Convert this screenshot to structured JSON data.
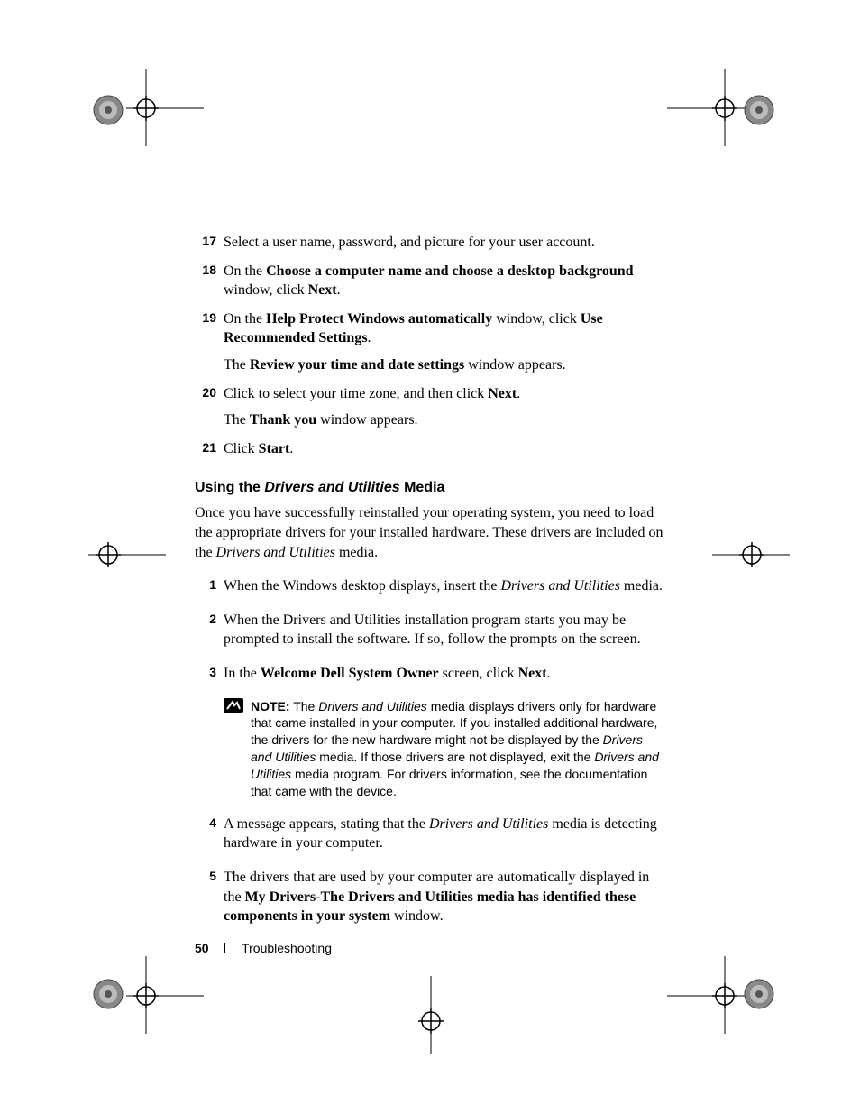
{
  "steps_a": [
    {
      "n": "17",
      "html": "Select a user name, password, and picture for your user account."
    },
    {
      "n": "18",
      "html": "On the <span class=\"b\">Choose a computer name and choose a desktop background</span> window, click <span class=\"b\">Next</span>."
    },
    {
      "n": "19",
      "html": "On the <span class=\"b\">Help Protect Windows automatically</span> window, click <span class=\"b\">Use Recommended Settings</span>.",
      "html2": "The <span class=\"b\">Review your time and date settings</span> window appears."
    },
    {
      "n": "20",
      "html": "Click to select your time zone, and then click <span class=\"b\">Next</span>.",
      "html2": "The <span class=\"b\">Thank you</span> window appears."
    },
    {
      "n": "21",
      "html": "Click <span class=\"b\">Start</span>."
    }
  ],
  "heading": {
    "pre": "Using the ",
    "em": "Drivers and Utilities",
    "post": " Media"
  },
  "intro": "Once you have successfully reinstalled your operating system, you need to load the appropriate drivers for your installed hardware. These drivers are included on the <span class=\"i\">Drivers and Utilities</span> media.",
  "steps_b": [
    {
      "n": "1",
      "html": "When the Windows desktop displays, insert the <span class=\"i\">Drivers and Utilities</span> media."
    },
    {
      "n": "2",
      "html": "When the Drivers and Utilities installation program starts you may be prompted to install the software. If so, follow the prompts on the screen."
    },
    {
      "n": "3",
      "html": "In the <span class=\"b\">Welcome Dell System Owner</span> screen, click <span class=\"b\">Next</span>."
    },
    {
      "n": "4",
      "html": "A message appears, stating that the <span class=\"i\">Drivers and Utilities</span> media is detecting hardware in your computer."
    },
    {
      "n": "5",
      "html": "The drivers that are used by your computer are automatically displayed in the <span class=\"b\">My Drivers-The Drivers and Utilities media has identified these components in your system</span> window."
    }
  ],
  "note": "<span class=\"b\">NOTE:</span> The <span class=\"i\">Drivers and Utilities</span> media displays drivers only for hardware that came installed in your computer. If you installed additional hardware, the drivers for the new hardware might not be displayed by the <span class=\"i\">Drivers and Utilities</span> media. If those drivers are not displayed, exit the <span class=\"i\">Drivers and Utilities</span> media program. For drivers information, see the documentation that came with the device.",
  "footer": {
    "page": "50",
    "section": "Troubleshooting"
  }
}
